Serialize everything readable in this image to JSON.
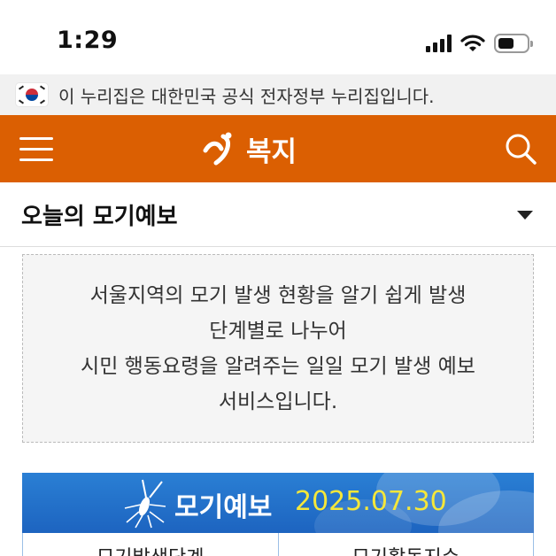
{
  "status_bar": {
    "time": "1:29",
    "battery_level": 0.55
  },
  "gov_banner": {
    "text": "이 누리집은 대한민국 공식 전자정부 누리집입니다."
  },
  "header": {
    "title": "복지",
    "icons": {
      "menu": "hamburger-menu-icon",
      "search": "search-icon",
      "logo": "seoul-logo-icon"
    },
    "colors": {
      "brand": "#db5f02"
    }
  },
  "section": {
    "title": "오늘의 모기예보"
  },
  "info": {
    "lines": [
      "서울지역의 모기 발생 현황을 알기 쉽게 발생",
      "단계별로 나누어",
      "시민 행동요령을 알려주는 일일 모기 발생 예보",
      "서비스입니다."
    ]
  },
  "forecast": {
    "label": "모기예보",
    "date": "2025.07.30",
    "colors": {
      "banner": "#1d64c0",
      "date": "#f5e73a"
    }
  },
  "table": {
    "headers": [
      "모기발생단계",
      "모기활동지수"
    ]
  }
}
